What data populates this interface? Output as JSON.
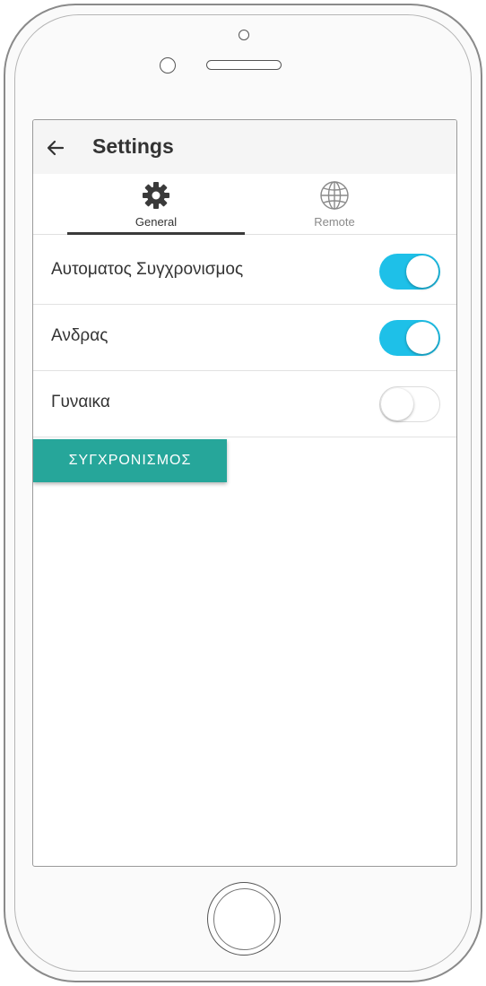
{
  "colors": {
    "accent": "#1ec0e8",
    "button": "#26a69a",
    "toggle_off_track": "#ffffff"
  },
  "header": {
    "back_icon": "arrow-left-icon",
    "title": "Settings"
  },
  "tabs": [
    {
      "label": "General",
      "icon": "gear-icon",
      "active": true
    },
    {
      "label": "Remote",
      "icon": "globe-icon",
      "active": false
    }
  ],
  "settings": [
    {
      "label": "Αυτοματος Συγχρονισμος",
      "enabled": true
    },
    {
      "label": "Ανδρας",
      "enabled": true
    },
    {
      "label": "Γυναικα",
      "enabled": false
    }
  ],
  "sync_button": {
    "label": "ΣΥΓΧΡΟΝΙΣΜΟΣ"
  }
}
